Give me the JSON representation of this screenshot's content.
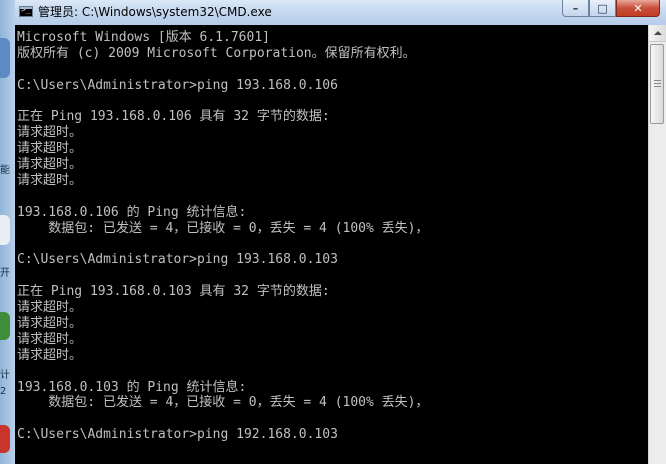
{
  "desktop": {
    "edge_glyphs": [
      "能",
      "开",
      "计",
      "2"
    ],
    "colors": {
      "strip": "#8fb4d8"
    }
  },
  "window": {
    "title": "管理员: C:\\Windows\\system32\\CMD.exe",
    "icon": "cmd-icon",
    "icon_glyph": ">_",
    "buttons": {
      "minimize": "–",
      "maximize": "□",
      "close": "✕"
    }
  },
  "console": {
    "colors": {
      "background": "#000000",
      "foreground": "#c0c0c0"
    },
    "lines": [
      "Microsoft Windows [版本 6.1.7601]",
      "版权所有 (c) 2009 Microsoft Corporation。保留所有权利。",
      "",
      "C:\\Users\\Administrator>ping 193.168.0.106",
      "",
      "正在 Ping 193.168.0.106 具有 32 字节的数据:",
      "请求超时。",
      "请求超时。",
      "请求超时。",
      "请求超时。",
      "",
      "193.168.0.106 的 Ping 统计信息:",
      "    数据包: 已发送 = 4，已接收 = 0，丢失 = 4 (100% 丢失)，",
      "",
      "C:\\Users\\Administrator>ping 193.168.0.103",
      "",
      "正在 Ping 193.168.0.103 具有 32 字节的数据:",
      "请求超时。",
      "请求超时。",
      "请求超时。",
      "请求超时。",
      "",
      "193.168.0.103 的 Ping 统计信息:",
      "    数据包: 已发送 = 4，已接收 = 0，丢失 = 4 (100% 丢失)，",
      "",
      "C:\\Users\\Administrator>ping 192.168.0.103"
    ]
  },
  "scrollbar": {
    "up_arrow_icon": "arrow-up-icon",
    "position": 0.0
  }
}
